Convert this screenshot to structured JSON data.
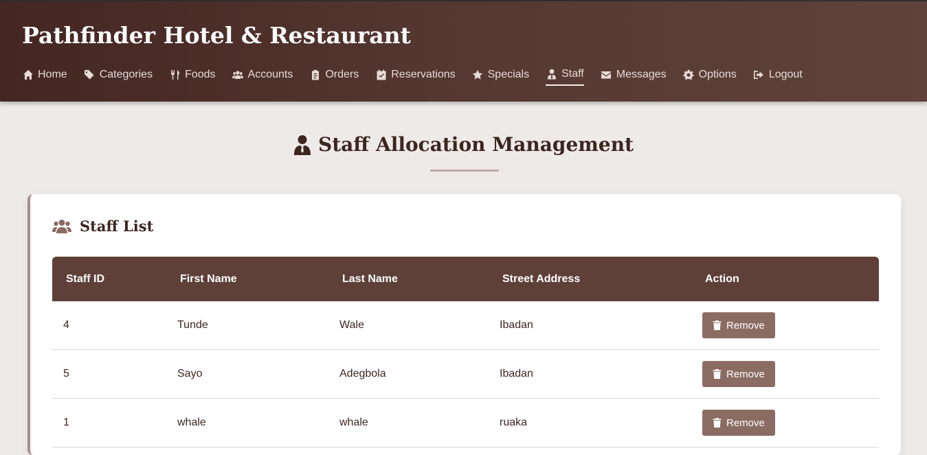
{
  "site": {
    "title": "Pathfinder Hotel & Restaurant"
  },
  "nav": {
    "items": [
      {
        "label": "Home",
        "icon": "home-icon"
      },
      {
        "label": "Categories",
        "icon": "tags-icon"
      },
      {
        "label": "Foods",
        "icon": "utensils-icon"
      },
      {
        "label": "Accounts",
        "icon": "users-icon"
      },
      {
        "label": "Orders",
        "icon": "clipboard-icon"
      },
      {
        "label": "Reservations",
        "icon": "calendar-check-icon"
      },
      {
        "label": "Specials",
        "icon": "star-icon"
      },
      {
        "label": "Staff",
        "icon": "user-tie-icon",
        "active": true
      },
      {
        "label": "Messages",
        "icon": "envelope-icon"
      },
      {
        "label": "Options",
        "icon": "gear-icon"
      },
      {
        "label": "Logout",
        "icon": "sign-out-icon"
      }
    ]
  },
  "page": {
    "title": "Staff Allocation Management"
  },
  "staff_list": {
    "title": "Staff List",
    "columns": [
      "Staff ID",
      "First Name",
      "Last Name",
      "Street Address",
      "Action"
    ],
    "rows": [
      {
        "id": "4",
        "first": "Tunde",
        "last": "Wale",
        "address": "Ibadan",
        "action": "Remove"
      },
      {
        "id": "5",
        "first": "Sayo",
        "last": "Adegbola",
        "address": "Ibadan",
        "action": "Remove"
      },
      {
        "id": "1",
        "first": "whale",
        "last": "whale",
        "address": "ruaka",
        "action": "Remove"
      }
    ]
  },
  "colors": {
    "header_start": "#442622",
    "header_end": "#5f433a",
    "table_header": "#5e4039",
    "button": "#8b6c63",
    "page_background": "#eeeae7"
  }
}
